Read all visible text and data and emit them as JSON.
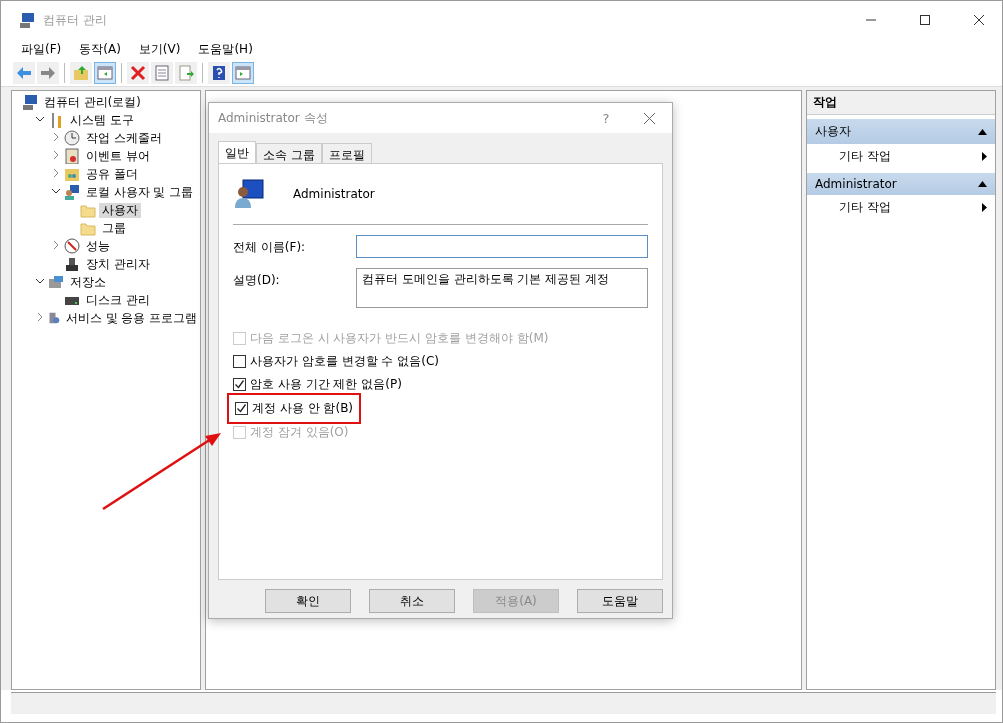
{
  "window": {
    "title": "컴퓨터 관리"
  },
  "menu": [
    "파일(F)",
    "동작(A)",
    "보기(V)",
    "도움말(H)"
  ],
  "toolbar": [
    [
      {
        "kind": "back",
        "pressed": false
      },
      {
        "kind": "forward",
        "pressed": false
      }
    ],
    [
      {
        "kind": "up",
        "pressed": false
      },
      {
        "kind": "tree",
        "pressed": true
      }
    ],
    [
      {
        "kind": "delete",
        "pressed": false
      },
      {
        "kind": "properties",
        "pressed": false
      },
      {
        "kind": "export",
        "pressed": false
      }
    ],
    [
      {
        "kind": "help",
        "pressed": false
      },
      {
        "kind": "actionpane",
        "pressed": true
      }
    ]
  ],
  "tree": [
    {
      "label": "컴퓨터 관리(로컬)",
      "kind": "computer",
      "selected": false,
      "children": [
        {
          "label": "시스템 도구",
          "kind": "tools",
          "expanded": true,
          "selected": false,
          "children": [
            {
              "label": "작업 스케줄러",
              "kind": "clock",
              "expanded": false,
              "selected": false
            },
            {
              "label": "이벤트 뷰어",
              "kind": "log",
              "expanded": false,
              "selected": false
            },
            {
              "label": "공유 폴더",
              "kind": "share",
              "expanded": false,
              "selected": false
            },
            {
              "label": "로컬 사용자 및 그룹",
              "kind": "users",
              "expanded": true,
              "selected": false,
              "children": [
                {
                  "label": "사용자",
                  "kind": "folder",
                  "selected": true
                },
                {
                  "label": "그룹",
                  "kind": "folder",
                  "selected": false
                }
              ]
            },
            {
              "label": "성능",
              "kind": "gauge",
              "expanded": false,
              "selected": false
            },
            {
              "label": "장치 관리자",
              "kind": "device",
              "selected": false
            }
          ]
        },
        {
          "label": "저장소",
          "kind": "storage",
          "expanded": true,
          "selected": false,
          "children": [
            {
              "label": "디스크 관리",
              "kind": "disk",
              "selected": false
            }
          ]
        },
        {
          "label": "서비스 및 응용 프로그램",
          "kind": "services",
          "expanded": false,
          "selected": false
        }
      ]
    }
  ],
  "actions": {
    "title": "작업",
    "sections": [
      {
        "title": "사용자",
        "expanded": true,
        "items": [
          "기타 작업"
        ]
      },
      {
        "title": "Administrator",
        "expanded": true,
        "items": [
          "기타 작업"
        ]
      }
    ]
  },
  "dialog": {
    "title": "Administrator 속성",
    "help": "?",
    "tabs": [
      {
        "label": "일반",
        "selected": true
      },
      {
        "label": "소속 그룹",
        "selected": false
      },
      {
        "label": "프로필",
        "selected": false
      }
    ],
    "user_name": "Administrator",
    "fields": [
      {
        "label": "전체 이름(F):",
        "kind": "line"
      },
      {
        "label": "설명(D):",
        "kind": "area",
        "value": "컴퓨터 도메인을 관리하도록 기본 제공된 계정"
      }
    ],
    "checkboxes": [
      {
        "label": "다음 로그온 시 사용자가 반드시 암호를 변경해야 함(M)",
        "checked": false,
        "disabled": true,
        "highlighted": false
      },
      {
        "label": "사용자가 암호를 변경할 수 없음(C)",
        "checked": false,
        "disabled": false,
        "highlighted": false
      },
      {
        "label": "암호 사용 기간 제한 없음(P)",
        "checked": true,
        "disabled": false,
        "highlighted": false
      },
      {
        "label": "계정 사용 안 함(B)",
        "checked": true,
        "disabled": false,
        "highlighted": true
      },
      {
        "label": "계정 잠겨 있음(O)",
        "checked": false,
        "disabled": true,
        "highlighted": false
      }
    ],
    "buttons": [
      {
        "label": "확인",
        "disabled": false
      },
      {
        "label": "취소",
        "disabled": false
      },
      {
        "label": "적용(A)",
        "disabled": true
      },
      {
        "label": "도움말",
        "disabled": false
      }
    ]
  }
}
